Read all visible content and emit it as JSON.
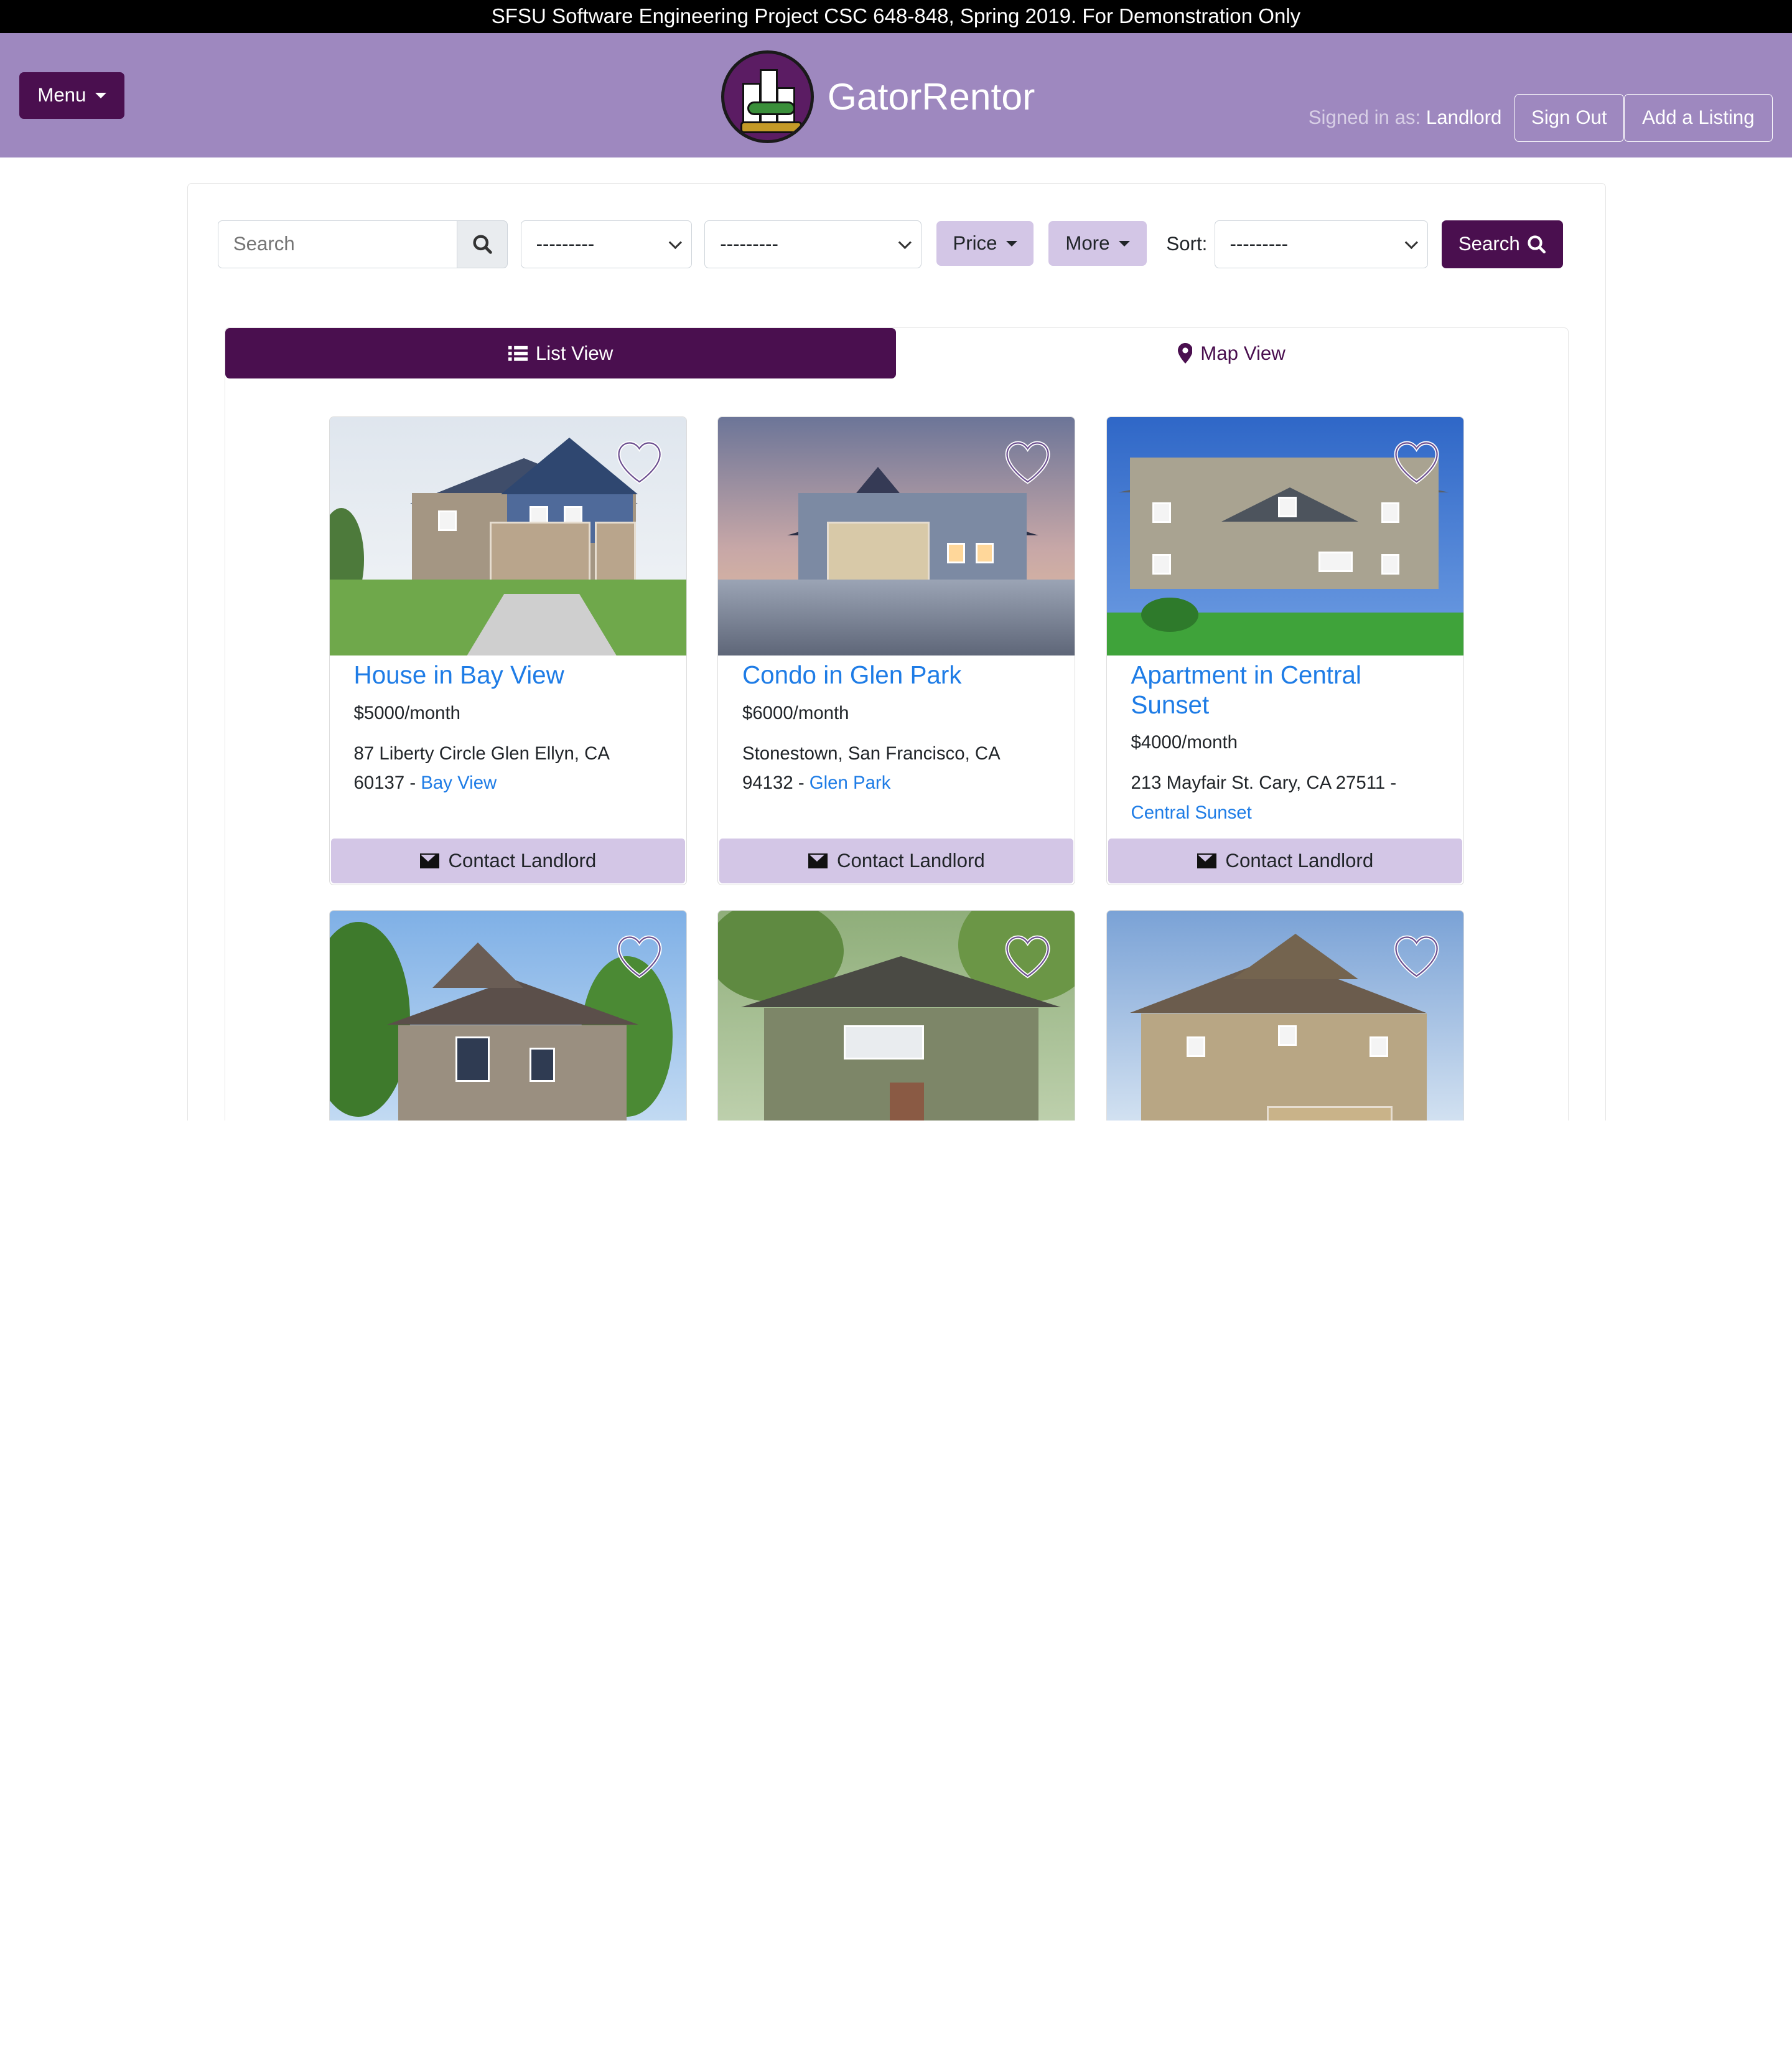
{
  "banner": {
    "text": "SFSU Software Engineering Project CSC 648-848, Spring 2019. For Demonstration Only"
  },
  "nav": {
    "menu_label": "Menu",
    "brand": "GatorRentor",
    "signed_in_prefix": "Signed in as:",
    "signed_in_user": "Landlord",
    "sign_out": "Sign Out",
    "add_listing": "Add a Listing"
  },
  "filters": {
    "search_placeholder": "Search",
    "select1_value": "---------",
    "select2_value": "---------",
    "price_label": "Price",
    "more_label": "More",
    "sort_label": "Sort:",
    "sort_value": "---------",
    "search_button": "Search"
  },
  "tabs": {
    "list": "List View",
    "map": "Map View"
  },
  "listings": [
    {
      "title": "House in Bay View",
      "price": "$5000/month",
      "address": "87 Liberty Circle Glen Ellyn, CA 60137 - ",
      "neighborhood": "Bay View",
      "contact": "Contact Landlord"
    },
    {
      "title": "Condo in Glen Park",
      "price": "$6000/month",
      "address": "Stonestown, San Francisco, CA 94132 - ",
      "neighborhood": "Glen Park",
      "contact": "Contact Landlord"
    },
    {
      "title": "Apartment in Central Sunset",
      "price": "$4000/month",
      "address": "213 Mayfair St. Cary, CA 27511 - ",
      "neighborhood": "Central Sunset",
      "contact": "Contact Landlord"
    }
  ],
  "colors": {
    "brand_purple": "#4a0f4f",
    "nav_lavender": "#9e88bf",
    "light_lavender": "#d3c6e6",
    "link_blue": "#1e7ce6"
  },
  "icons": [
    "search-icon",
    "list-icon",
    "map-marker-icon",
    "heart-icon",
    "envelope-icon"
  ]
}
